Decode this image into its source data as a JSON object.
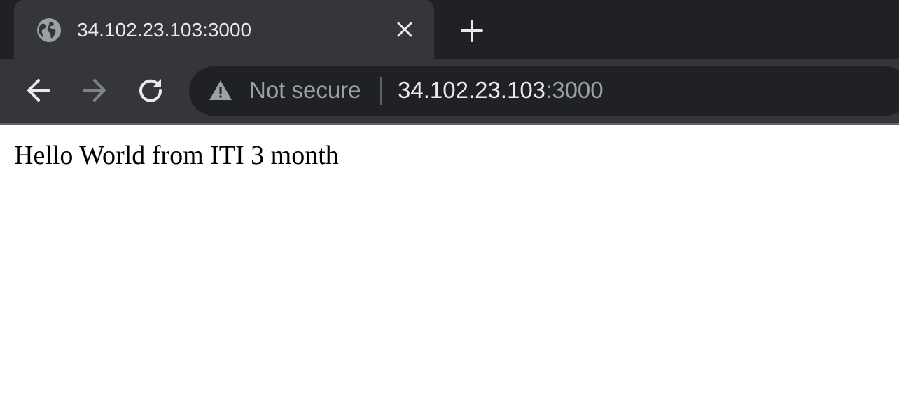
{
  "tab": {
    "title": "34.102.23.103:3000",
    "favicon": "globe-icon",
    "close": "close-icon"
  },
  "new_tab": {
    "icon": "plus-icon"
  },
  "toolbar": {
    "back": "arrow-left-icon",
    "forward": "arrow-right-icon",
    "reload": "reload-icon"
  },
  "omnibox": {
    "security_icon": "warning-triangle-icon",
    "security_label": "Not secure",
    "url_host": "34.102.23.103",
    "url_port": ":3000"
  },
  "page": {
    "text": "Hello World from ITI 3 month"
  },
  "colors": {
    "tab_strip": "#202124",
    "active_tab": "#35363a",
    "toolbar": "#35363a",
    "omnibox": "#202124",
    "text_primary": "#e8eaed",
    "text_muted": "#9aa0a6",
    "page_background": "#ffffff"
  }
}
